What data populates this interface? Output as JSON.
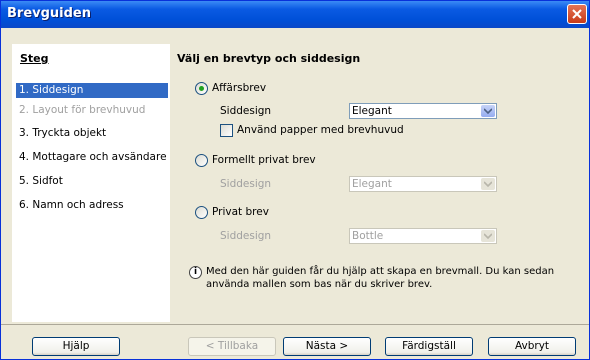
{
  "window": {
    "title": "Brevguiden"
  },
  "steps": {
    "heading": "Steg",
    "items": [
      {
        "label": "1. Siddesign",
        "state": "active"
      },
      {
        "label": "2. Layout för brevhuvud",
        "state": "disabled"
      },
      {
        "label": "3. Tryckta objekt",
        "state": "normal"
      },
      {
        "label": "4. Mottagare och avsändare",
        "state": "normal"
      },
      {
        "label": "5. Sidfot",
        "state": "normal"
      },
      {
        "label": "6. Namn och adress",
        "state": "normal"
      }
    ]
  },
  "content": {
    "heading": "Välj en brevtyp och siddesign",
    "options": [
      {
        "label": "Affärsbrev",
        "selected": true,
        "design_label": "Siddesign",
        "design_value": "Elegant"
      },
      {
        "label": "Formellt privat brev",
        "selected": false,
        "design_label": "Siddesign",
        "design_value": "Elegant"
      },
      {
        "label": "Privat brev",
        "selected": false,
        "design_label": "Siddesign",
        "design_value": "Bottle"
      }
    ],
    "letterhead_checkbox": {
      "label": "Använd papper med brevhuvud",
      "checked": false
    },
    "info_icon_glyph": "i",
    "info_text": "Med den här guiden får du hjälp att skapa en brevmall. Du kan sedan använda mallen som bas när du skriver brev."
  },
  "buttons": {
    "help": "Hjälp",
    "back": "< Tillbaka",
    "next": "Nästa >",
    "finish": "Färdigställ",
    "cancel": "Avbryt"
  },
  "colors": {
    "titlebar": "#0a5ae3",
    "selection": "#316ac5",
    "disabled_text": "#a0a0a0"
  }
}
